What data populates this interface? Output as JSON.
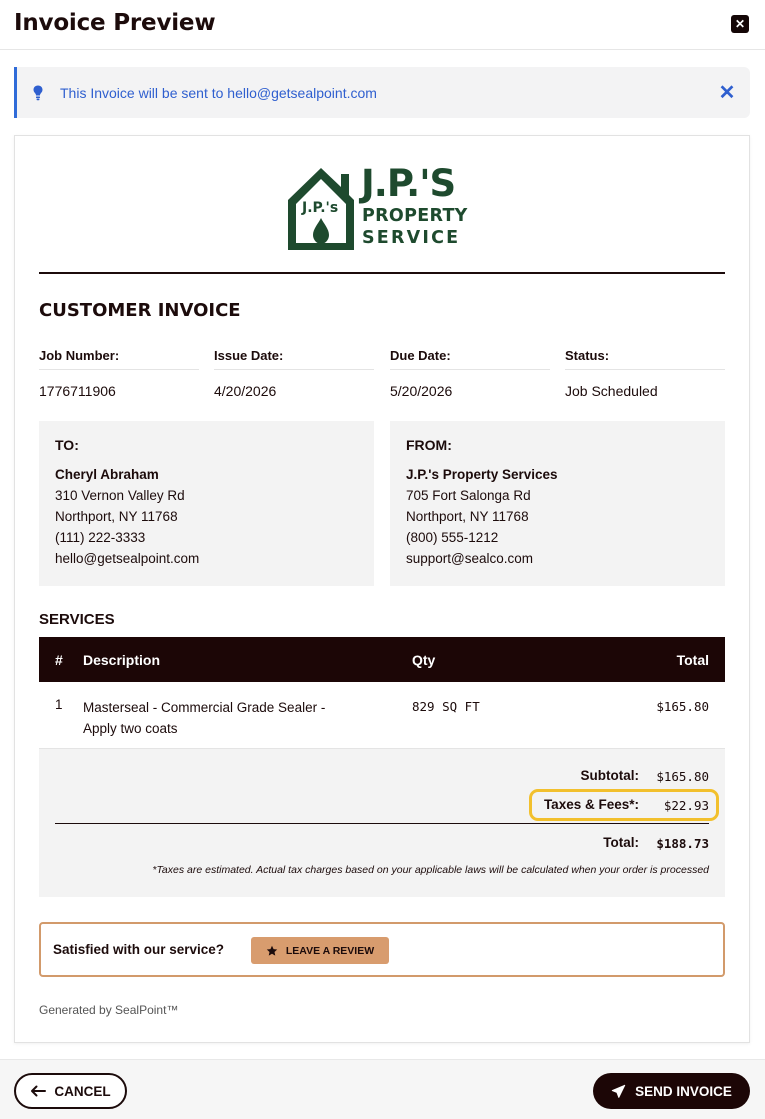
{
  "header": {
    "title": "Invoice Preview",
    "close_icon": "close-icon"
  },
  "banner": {
    "text": "This Invoice will be sent to hello@getsealpoint.com",
    "icon": "lightbulb-icon",
    "close_icon": "close-icon",
    "accent": "#2f5fcf"
  },
  "logo": {
    "line1": "J.P.'S",
    "line2": "PROPERTY",
    "line3": "SERVICE",
    "house_text": "J.P.'s",
    "brand_color": "#1e4a2e"
  },
  "invoice": {
    "title": "CUSTOMER INVOICE",
    "meta": [
      {
        "label": "Job Number:",
        "value": "1776711906"
      },
      {
        "label": "Issue Date:",
        "value": "4/20/2026"
      },
      {
        "label": "Due Date:",
        "value": "5/20/2026"
      },
      {
        "label": "Status:",
        "value": "Job Scheduled"
      }
    ]
  },
  "to": {
    "heading": "TO:",
    "name": "Cheryl Abraham",
    "lines": [
      "310 Vernon Valley Rd",
      "Northport, NY 11768",
      "(111) 222-3333",
      "hello@getsealpoint.com"
    ]
  },
  "from": {
    "heading": "FROM:",
    "name": "J.P.'s Property Services",
    "lines": [
      "705 Fort Salonga Rd",
      "Northport, NY 11768",
      "(800) 555-1212",
      "support@sealco.com"
    ]
  },
  "services": {
    "title": "SERVICES",
    "columns": [
      "#",
      "Description",
      "Qty",
      "Total"
    ],
    "rows": [
      {
        "num": "1",
        "desc1": "Masterseal - Commercial Grade Sealer -",
        "desc2": "Apply two coats",
        "qty": "829 SQ FT",
        "total": "$165.80"
      }
    ]
  },
  "totals": {
    "subtotal_label": "Subtotal:",
    "subtotal": "$165.80",
    "taxes_label": "Taxes & Fees*:",
    "taxes": "$22.93",
    "total_label": "Total:",
    "total": "$188.73",
    "note": "*Taxes are estimated. Actual tax charges based on your applicable laws will be calculated when your order is processed",
    "highlight_color": "#f2c02d"
  },
  "review": {
    "prompt": "Satisfied with our service?",
    "button": "LEAVE A REVIEW",
    "icon": "star-icon"
  },
  "generated": "Generated by SealPoint™",
  "footer": {
    "cancel": "CANCEL",
    "cancel_icon": "arrow-left-icon",
    "send": "SEND INVOICE",
    "send_icon": "paper-plane-icon"
  }
}
